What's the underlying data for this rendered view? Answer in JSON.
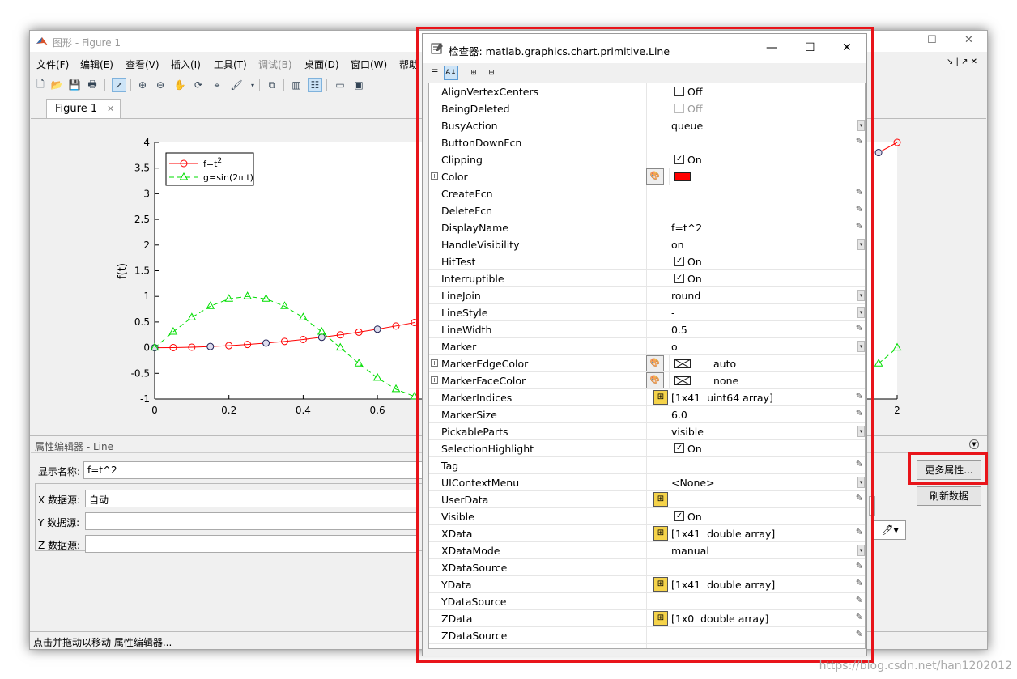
{
  "figure": {
    "title": "图形 - Figure 1",
    "menu": [
      "文件(F)",
      "编辑(E)",
      "查看(V)",
      "插入(I)",
      "工具(T)",
      "调试(B)",
      "桌面(D)",
      "窗口(W)",
      "帮助"
    ],
    "tab": "Figure 1",
    "status": "点击并拖动以移动 属性编辑器..."
  },
  "chart_data": {
    "type": "line",
    "ylabel": "f(t)",
    "xlabel": "",
    "xlim": [
      0,
      2
    ],
    "ylim": [
      -1,
      4
    ],
    "xticks": [
      "0",
      "0.2",
      "0.4",
      "0.6",
      "2"
    ],
    "yticks": [
      "-1",
      "-0.5",
      "0",
      "0.5",
      "1",
      "1.5",
      "2",
      "2.5",
      "3",
      "3.5",
      "4"
    ],
    "legend": "top-left",
    "series": [
      {
        "name": "f=t^2",
        "color": "#ff0000",
        "marker": "o",
        "linestyle": "-",
        "x": [
          0,
          0.05,
          0.1,
          0.15,
          0.2,
          0.25,
          0.3,
          0.35,
          0.4,
          0.45,
          0.5,
          0.55,
          0.6,
          0.65,
          0.7,
          1.95,
          2
        ],
        "y": [
          0,
          0.0025,
          0.01,
          0.0225,
          0.04,
          0.0625,
          0.09,
          0.1225,
          0.16,
          0.2025,
          0.25,
          0.3025,
          0.36,
          0.4225,
          0.49,
          3.8025,
          4
        ]
      },
      {
        "name": "g=sin(2π t)",
        "color": "#00dd00",
        "marker": "^",
        "linestyle": "--",
        "x": [
          0,
          0.05,
          0.1,
          0.15,
          0.2,
          0.25,
          0.3,
          0.35,
          0.4,
          0.45,
          0.5,
          0.55,
          0.6,
          0.65,
          0.7,
          1.95,
          2
        ],
        "y": [
          0,
          0.309,
          0.588,
          0.809,
          0.951,
          1,
          0.951,
          0.809,
          0.588,
          0.309,
          0,
          -0.309,
          -0.588,
          -0.809,
          -0.951,
          -0.309,
          0
        ]
      }
    ]
  },
  "legend": {
    "f_label": "f=t",
    "f_sup": "2",
    "g_label": "g=sin(2π t)"
  },
  "property_editor": {
    "title": "属性编辑器 - Line",
    "display_name_label": "显示名称:",
    "display_name": "f=t^2",
    "x_label": "X 数据源:",
    "x_value": "自动",
    "y_label": "Y 数据源:",
    "z_label": "Z 数据源:",
    "more_props": "更多属性...",
    "refresh": "刷新数据"
  },
  "inspector": {
    "title": "检查器:  matlab.graphics.chart.primitive.Line",
    "rows": [
      {
        "name": "AlignVertexCenters",
        "type": "check",
        "checked": false,
        "value": "Off"
      },
      {
        "name": "BeingDeleted",
        "type": "check",
        "checked": false,
        "value": "Off",
        "disabled": true
      },
      {
        "name": "BusyAction",
        "type": "dropdown",
        "value": "queue"
      },
      {
        "name": "ButtonDownFcn",
        "type": "edit",
        "value": ""
      },
      {
        "name": "Clipping",
        "type": "check",
        "checked": true,
        "value": "On"
      },
      {
        "name": "Color",
        "type": "color",
        "expand": true,
        "value": ""
      },
      {
        "name": "CreateFcn",
        "type": "edit",
        "value": ""
      },
      {
        "name": "DeleteFcn",
        "type": "edit",
        "value": ""
      },
      {
        "name": "DisplayName",
        "type": "edit",
        "value": "f=t^2"
      },
      {
        "name": "HandleVisibility",
        "type": "dropdown",
        "value": "on"
      },
      {
        "name": "HitTest",
        "type": "check",
        "checked": true,
        "value": "On"
      },
      {
        "name": "Interruptible",
        "type": "check",
        "checked": true,
        "value": "On"
      },
      {
        "name": "LineJoin",
        "type": "dropdown",
        "value": "round"
      },
      {
        "name": "LineStyle",
        "type": "dropdown",
        "value": "-"
      },
      {
        "name": "LineWidth",
        "type": "edit",
        "value": "0.5"
      },
      {
        "name": "Marker",
        "type": "dropdown",
        "value": "o"
      },
      {
        "name": "MarkerEdgeColor",
        "type": "colorx",
        "expand": true,
        "value": "auto"
      },
      {
        "name": "MarkerFaceColor",
        "type": "colorx",
        "expand": true,
        "value": "none"
      },
      {
        "name": "MarkerIndices",
        "type": "array",
        "value": "[1x41  uint64 array]"
      },
      {
        "name": "MarkerSize",
        "type": "edit",
        "value": "6.0"
      },
      {
        "name": "PickableParts",
        "type": "dropdown",
        "value": "visible"
      },
      {
        "name": "SelectionHighlight",
        "type": "check",
        "checked": true,
        "value": "On"
      },
      {
        "name": "Tag",
        "type": "edit",
        "value": ""
      },
      {
        "name": "UIContextMenu",
        "type": "dropdown",
        "value": "<None>"
      },
      {
        "name": "UserData",
        "type": "array",
        "value": ""
      },
      {
        "name": "Visible",
        "type": "check",
        "checked": true,
        "value": "On"
      },
      {
        "name": "XData",
        "type": "array",
        "value": "[1x41  double array]"
      },
      {
        "name": "XDataMode",
        "type": "dropdown",
        "value": "manual"
      },
      {
        "name": "XDataSource",
        "type": "edit",
        "value": ""
      },
      {
        "name": "YData",
        "type": "array",
        "value": "[1x41  double array]"
      },
      {
        "name": "YDataSource",
        "type": "edit",
        "value": ""
      },
      {
        "name": "ZData",
        "type": "array",
        "value": "[1x0  double array]"
      },
      {
        "name": "ZDataSource",
        "type": "edit",
        "value": ""
      }
    ]
  },
  "watermark": "https://blog.csdn.net/han1202012",
  "colors": {
    "highlight": "#e8141a",
    "line_color": "#ff0000"
  }
}
